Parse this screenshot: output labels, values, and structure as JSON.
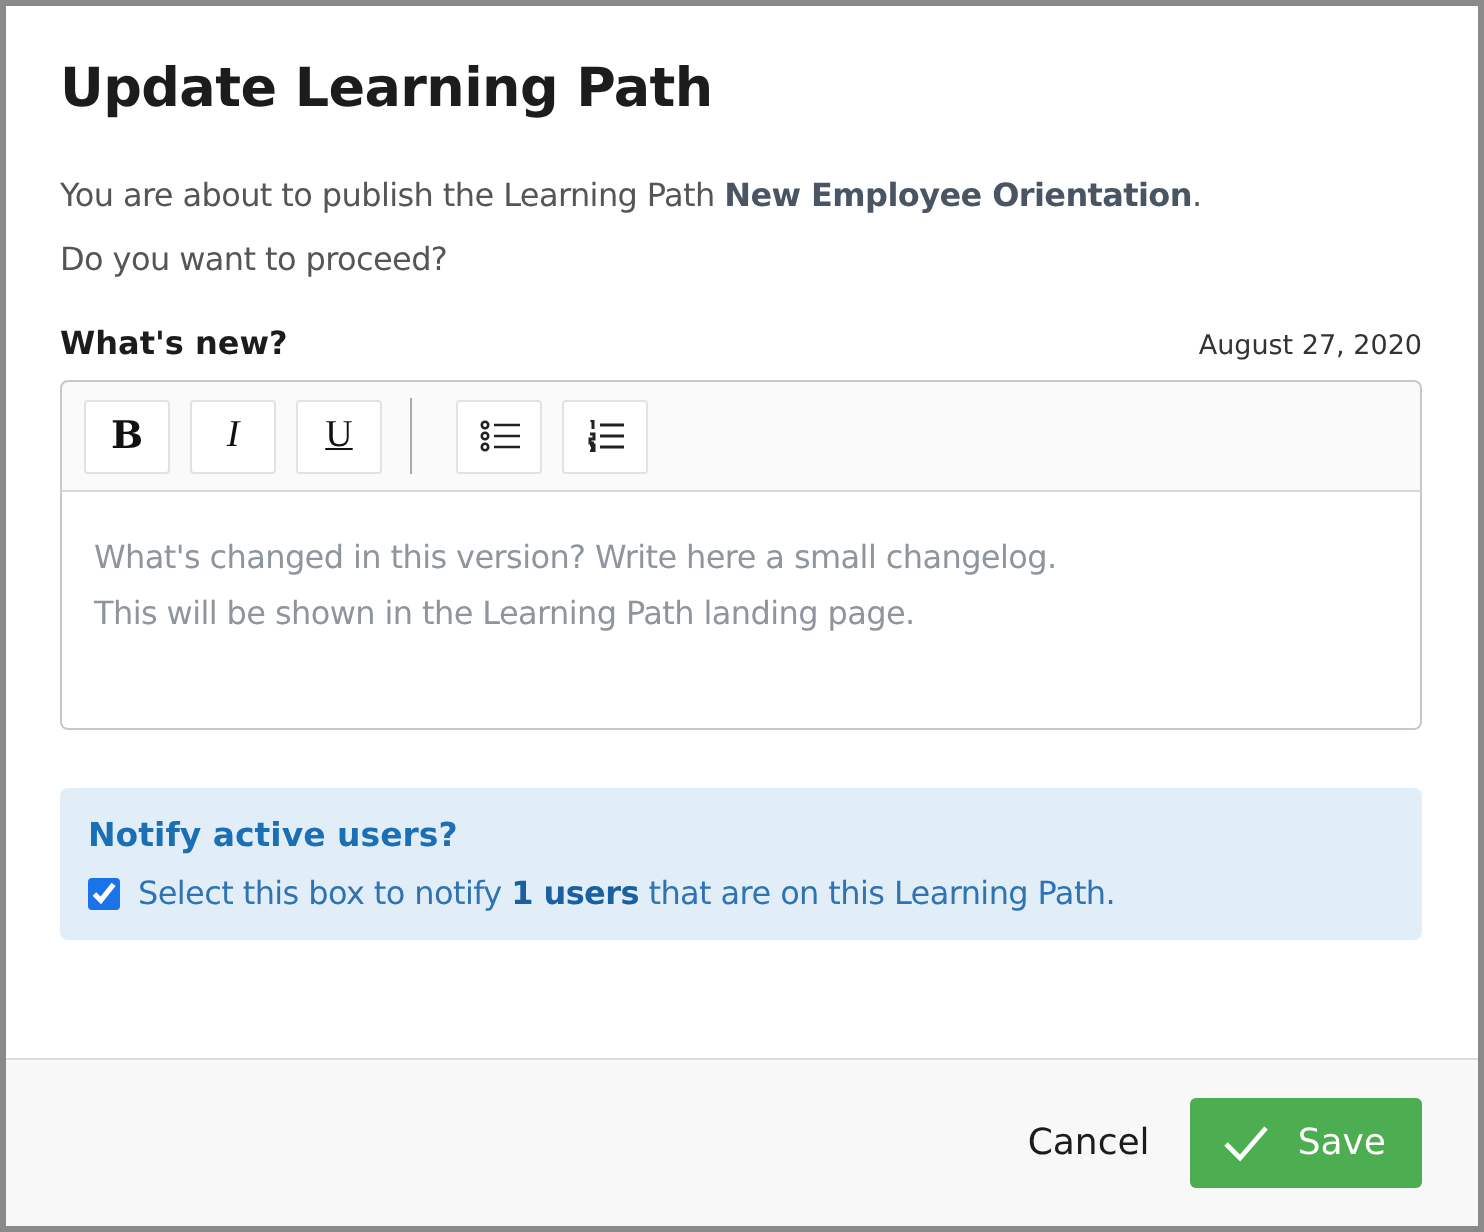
{
  "dialog": {
    "title": "Update Learning Path",
    "intro": "You are about to publish the Learning Path **New Employee Orientation**.",
    "question": "Do you want to proceed?",
    "editor": {
      "label": "What's new?",
      "date": "August 27, 2020",
      "toolbar": [
        {
          "kind": "bold",
          "label": "B"
        },
        {
          "kind": "italic",
          "label": "I"
        },
        {
          "kind": "underline",
          "label": "U"
        },
        {
          "kind": "bullet-list"
        },
        {
          "kind": "numbered-list"
        }
      ],
      "placeholder": "What's changed in this version? Write here a small changelog.\nThis will be shown in the Learning Path landing page."
    },
    "notify": {
      "title": "Notify active users?",
      "checked": true,
      "text": "Select this box to notify **1 users** that are on this Learning Path."
    },
    "buttons": [
      {
        "kind": "cancel",
        "label": "Cancel"
      },
      {
        "kind": "save",
        "label": "Save"
      }
    ]
  }
}
